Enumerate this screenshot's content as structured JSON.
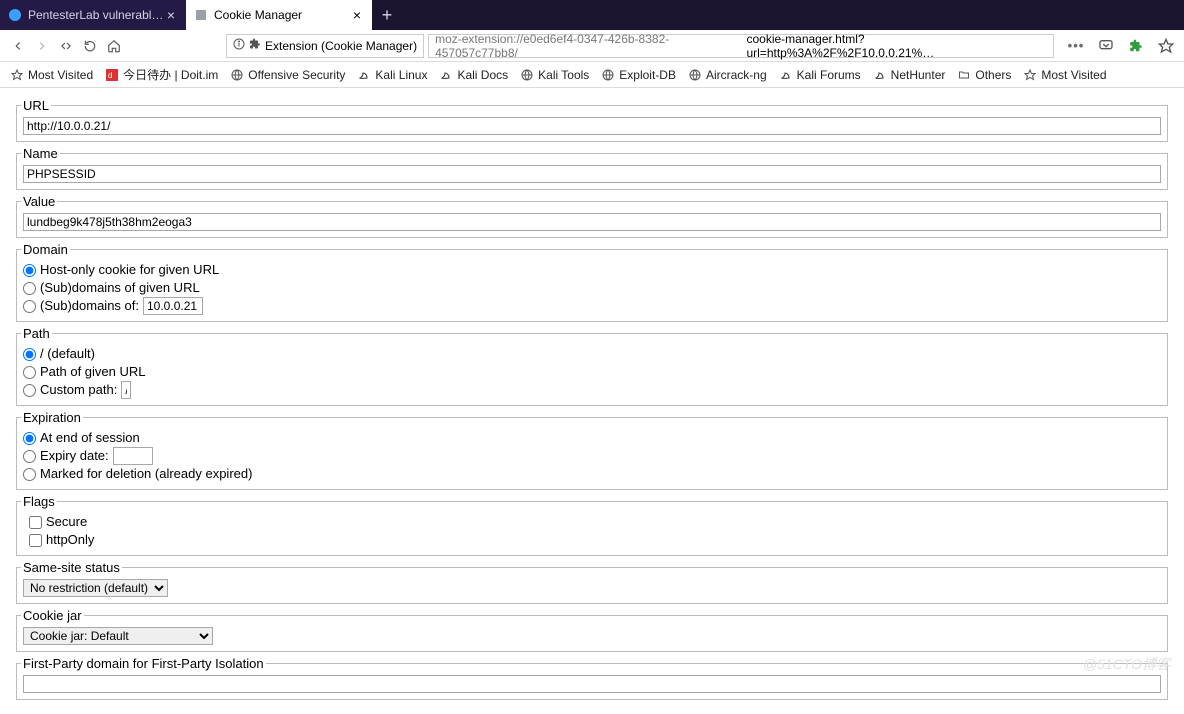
{
  "tabs": {
    "inactive": {
      "title": "PentesterLab vulnerable blo…"
    },
    "active": {
      "title": "Cookie Manager"
    }
  },
  "urlbar": {
    "identity": "Extension (Cookie Manager)",
    "url_prefix": "moz-extension://e0ed6ef4-0347-426b-8382-457057c77bb8/",
    "url_rest": "cookie-manager.html?url=http%3A%2F%2F10.0.0.21%…"
  },
  "bookmarks": [
    {
      "icon": "star",
      "label": "Most Visited"
    },
    {
      "icon": "doit",
      "label": "今日待办 | Doit.im"
    },
    {
      "icon": "globe",
      "label": "Offensive Security"
    },
    {
      "icon": "dragon",
      "label": "Kali Linux"
    },
    {
      "icon": "dragon",
      "label": "Kali Docs"
    },
    {
      "icon": "globe",
      "label": "Kali Tools"
    },
    {
      "icon": "globe",
      "label": "Exploit-DB"
    },
    {
      "icon": "globe",
      "label": "Aircrack-ng"
    },
    {
      "icon": "dragon",
      "label": "Kali Forums"
    },
    {
      "icon": "dragon",
      "label": "NetHunter"
    },
    {
      "icon": "folder",
      "label": "Others"
    },
    {
      "icon": "star",
      "label": "Most Visited"
    }
  ],
  "form": {
    "url": {
      "legend": "URL",
      "value": "http://10.0.0.21/"
    },
    "name": {
      "legend": "Name",
      "value": "PHPSESSID"
    },
    "value": {
      "legend": "Value",
      "value": "lundbeg9k478j5th38hm2eoga3"
    },
    "domain": {
      "legend": "Domain",
      "opt1": "Host-only cookie for given URL",
      "opt2": "(Sub)domains of given URL",
      "opt3_prefix": "(Sub)domains of:",
      "opt3_value": "10.0.0.21"
    },
    "path": {
      "legend": "Path",
      "opt1": "/ (default)",
      "opt2": "Path of given URL",
      "opt3_prefix": "Custom path:",
      "opt3_value": "/"
    },
    "expiration": {
      "legend": "Expiration",
      "opt1": "At end of session",
      "opt2_prefix": "Expiry date:",
      "opt2_value": "",
      "opt3": "Marked for deletion (already expired)"
    },
    "flags": {
      "legend": "Flags",
      "secure": "Secure",
      "httponly": "httpOnly"
    },
    "samesite": {
      "legend": "Same-site status",
      "selected": "No restriction (default)"
    },
    "cookiejar": {
      "legend": "Cookie jar",
      "selected": "Cookie jar: Default"
    },
    "firstparty": {
      "legend": "First-Party domain for First-Party Isolation",
      "value": ""
    }
  },
  "watermark": "@51CTO博客"
}
